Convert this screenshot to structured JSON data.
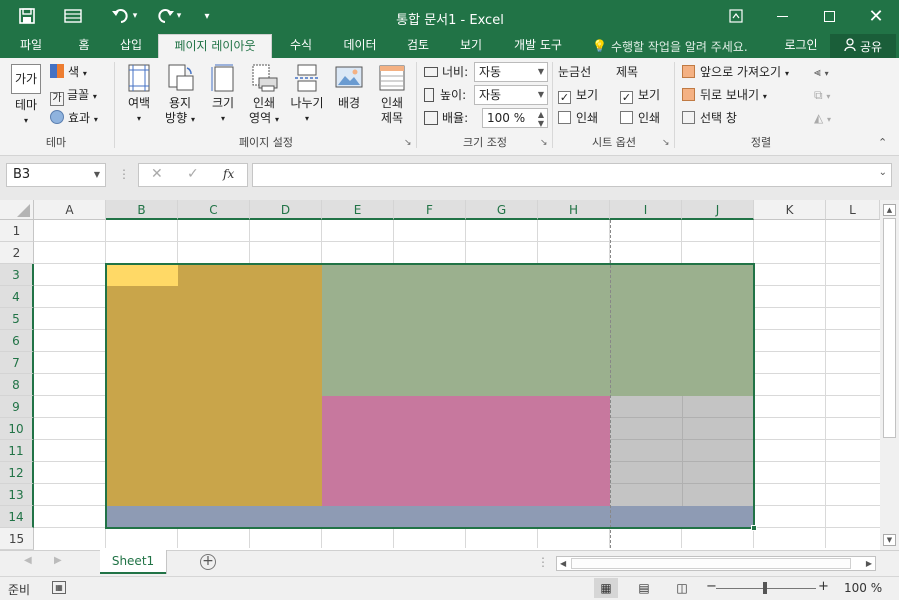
{
  "window": {
    "title": "통합 문서1 - Excel"
  },
  "quick_access": {
    "save": "save-icon",
    "touch": "touch-mode-icon",
    "undo": "undo-icon",
    "redo": "redo-icon",
    "customize": "customize-icon"
  },
  "tabs": [
    {
      "label": "파일"
    },
    {
      "label": "홈"
    },
    {
      "label": "삽입"
    },
    {
      "label": "페이지 레이아웃"
    },
    {
      "label": "수식"
    },
    {
      "label": "데이터"
    },
    {
      "label": "검토"
    },
    {
      "label": "보기"
    },
    {
      "label": "개발 도구"
    }
  ],
  "tell_me": "수행할 작업을 알려 주세요.",
  "login": "로그인",
  "share": "공유",
  "ribbon": {
    "theme": {
      "main": "테마",
      "colors": "색",
      "fonts": "글꼴",
      "effects": "효과",
      "group": "테마"
    },
    "page_setup": {
      "margins": "여백",
      "orientation_1": "용지",
      "orientation_2": "방향",
      "size": "크기",
      "print_area_1": "인쇄",
      "print_area_2": "영역",
      "breaks": "나누기",
      "background": "배경",
      "print_titles_1": "인쇄",
      "print_titles_2": "제목",
      "group": "페이지 설정"
    },
    "scale": {
      "width_label": "너비:",
      "width_value": "자동",
      "height_label": "높이:",
      "height_value": "자동",
      "scale_label": "배율:",
      "scale_value": "100 %",
      "group": "크기 조정"
    },
    "sheet_options": {
      "gridlines": "눈금선",
      "headings": "제목",
      "view1": "보기",
      "print1": "인쇄",
      "view2": "보기",
      "print2": "인쇄",
      "group": "시트 옵션"
    },
    "arrange": {
      "bring_forward": "앞으로 가져오기",
      "send_backward": "뒤로 보내기",
      "selection_pane": "선택 창",
      "group": "정렬"
    }
  },
  "formula_bar": {
    "name_box": "B3",
    "fx": "fx",
    "value": ""
  },
  "columns": [
    "A",
    "B",
    "C",
    "D",
    "E",
    "F",
    "G",
    "H",
    "I",
    "J",
    "K",
    "L"
  ],
  "rows": [
    "1",
    "2",
    "3",
    "4",
    "5",
    "6",
    "7",
    "8",
    "9",
    "10",
    "11",
    "12",
    "13",
    "14",
    "15"
  ],
  "sheet_tab": "Sheet1",
  "status": {
    "mode": "준비",
    "zoom": "100 %"
  },
  "colors": {
    "accent": "#217346",
    "theme1": "#ffd966",
    "theme2": "#c9a54a",
    "theme3": "#9bb08e",
    "theme4": "#c7789e",
    "theme5": "#c4c4c4",
    "theme6": "#8e9bb4"
  }
}
